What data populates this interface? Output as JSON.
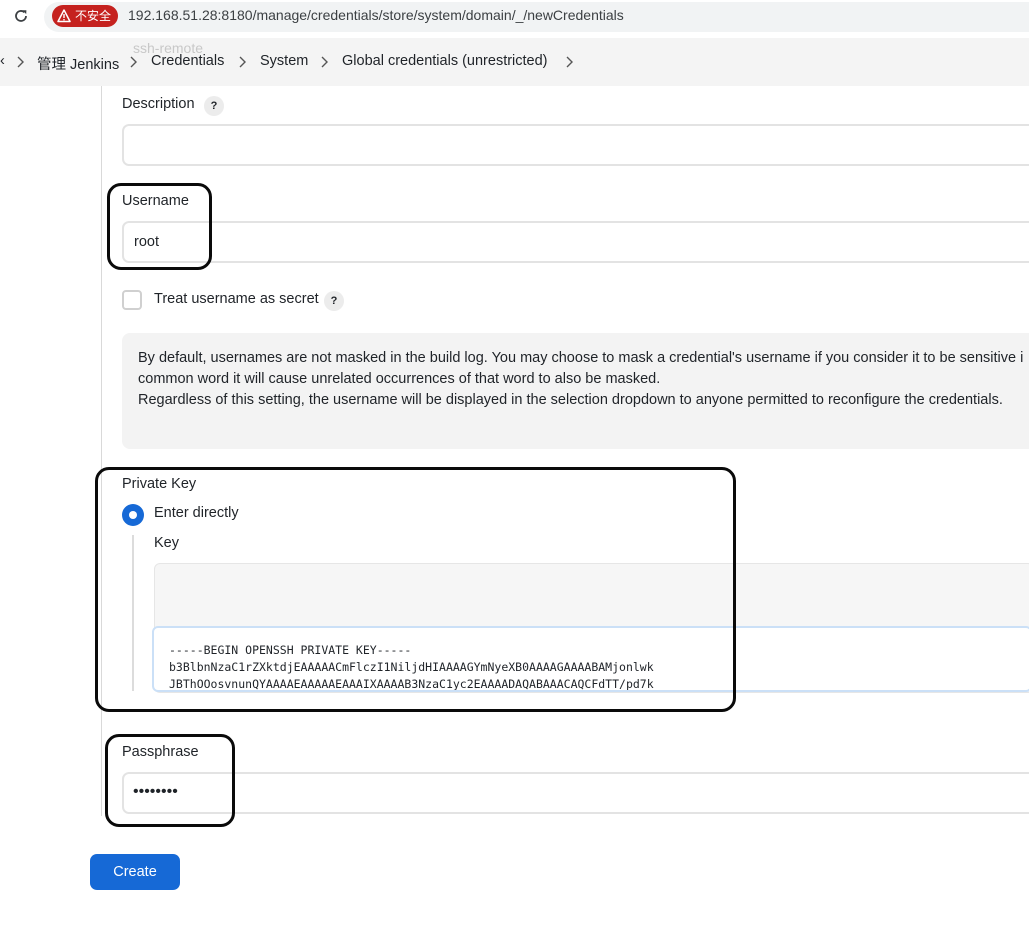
{
  "browser": {
    "insecure_label": "不安全",
    "url": "192.168.51.28:8180/manage/credentials/store/system/domain/_/newCredentials"
  },
  "breadcrumb": {
    "edge_fragment": "‹",
    "ghost_text": "ssh-remote",
    "items": [
      "管理 Jenkins",
      "Credentials",
      "System",
      "Global credentials (unrestricted)"
    ]
  },
  "form": {
    "description": {
      "label": "Description",
      "help": "?",
      "value": ""
    },
    "username": {
      "label": "Username",
      "value": "root"
    },
    "username_secret": {
      "label": "Treat username as secret",
      "help": "?",
      "checked": false
    },
    "info": {
      "line1": "By default, usernames are not masked in the build log. You may choose to mask a credential's username if you consider it to be sensitive i",
      "line2": "common word it will cause unrelated occurrences of that word to also be masked.",
      "line3": "Regardless of this setting, the username will be displayed in the selection dropdown to anyone permitted to reconfigure the credentials."
    },
    "private_key": {
      "label": "Private Key",
      "option": "Enter directly",
      "key_label": "Key",
      "key_lines": [
        "-----BEGIN OPENSSH PRIVATE KEY-----",
        "b3BlbnNzaC1rZXktdjEAAAAACmFlczI1NiljdHIAAAAGYmNyeXB0AAAAGAAAABAMjonlwk",
        "JBThOOosvnunQYAAAAEAAAAAEAAAIXAAAAB3NzaC1yc2EAAAADAQABAAACAQCFdTT/pd7k"
      ]
    },
    "passphrase": {
      "label": "Passphrase",
      "masked_value": "••••••••"
    },
    "submit_label": "Create"
  },
  "colors": {
    "primary": "#1669d6",
    "insecure": "#c5221f",
    "annotation": "#0a0a0a"
  }
}
